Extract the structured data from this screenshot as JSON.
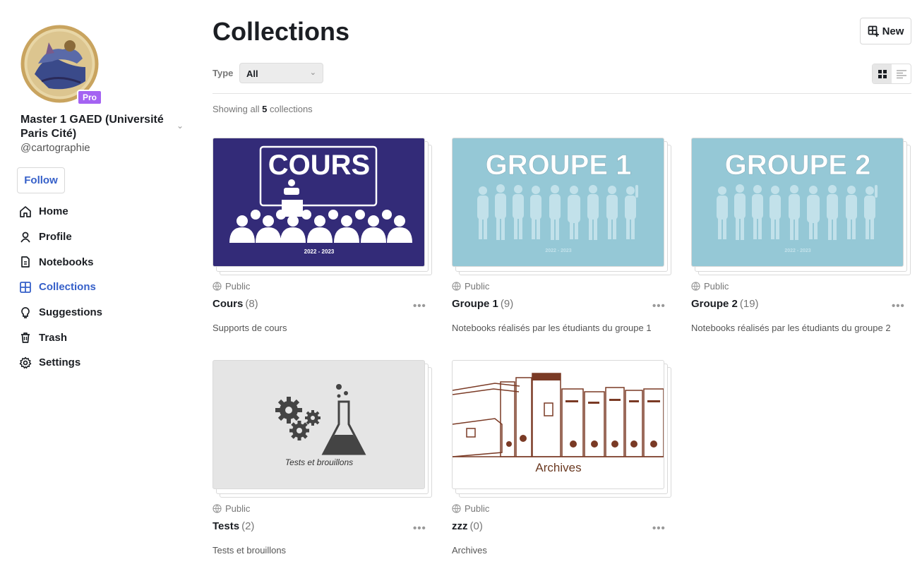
{
  "sidebar": {
    "badge": "Pro",
    "org_name": "Master 1 GAED (Université Paris Cité)",
    "handle": "@cartographie",
    "follow_label": "Follow",
    "nav": [
      {
        "label": "Home",
        "icon": "home-icon"
      },
      {
        "label": "Profile",
        "icon": "person-icon"
      },
      {
        "label": "Notebooks",
        "icon": "notebook-icon"
      },
      {
        "label": "Collections",
        "icon": "grid-icon",
        "active": true
      },
      {
        "label": "Suggestions",
        "icon": "lightbulb-icon"
      },
      {
        "label": "Trash",
        "icon": "trash-icon"
      },
      {
        "label": "Settings",
        "icon": "gear-icon"
      }
    ]
  },
  "main": {
    "title": "Collections",
    "new_label": "New",
    "type_label": "Type",
    "type_value": "All",
    "showing_prefix": "Showing all",
    "showing_count": "5",
    "showing_suffix": "collections"
  },
  "thumbs": {
    "cours_title": "COURS",
    "cours_year": "2022 - 2023",
    "g1_title": "GROUPE 1",
    "g1_year": "2022 - 2023",
    "g2_title": "GROUPE 2",
    "g2_year": "2022 - 2023",
    "tests_caption": "Tests et brouillons",
    "archives_caption": "Archives"
  },
  "collections": [
    {
      "visibility": "Public",
      "title": "Cours",
      "count": "(8)",
      "description": "Supports de cours"
    },
    {
      "visibility": "Public",
      "title": "Groupe 1",
      "count": "(9)",
      "description": "Notebooks réalisés par les étudiants du groupe 1"
    },
    {
      "visibility": "Public",
      "title": "Groupe 2",
      "count": "(19)",
      "description": "Notebooks réalisés par les étudiants du groupe 2"
    },
    {
      "visibility": "Public",
      "title": "Tests",
      "count": "(2)",
      "description": "Tests et brouillons"
    },
    {
      "visibility": "Public",
      "title": "zzz",
      "count": "(0)",
      "description": "Archives"
    }
  ],
  "colors": {
    "accent": "#3660c9",
    "pro": "#a463f2",
    "cours_bg": "#332b78",
    "groupe_bg": "#95c8d6",
    "tests_bg": "#e5e5e5",
    "archives_ink": "#7a3a25"
  }
}
